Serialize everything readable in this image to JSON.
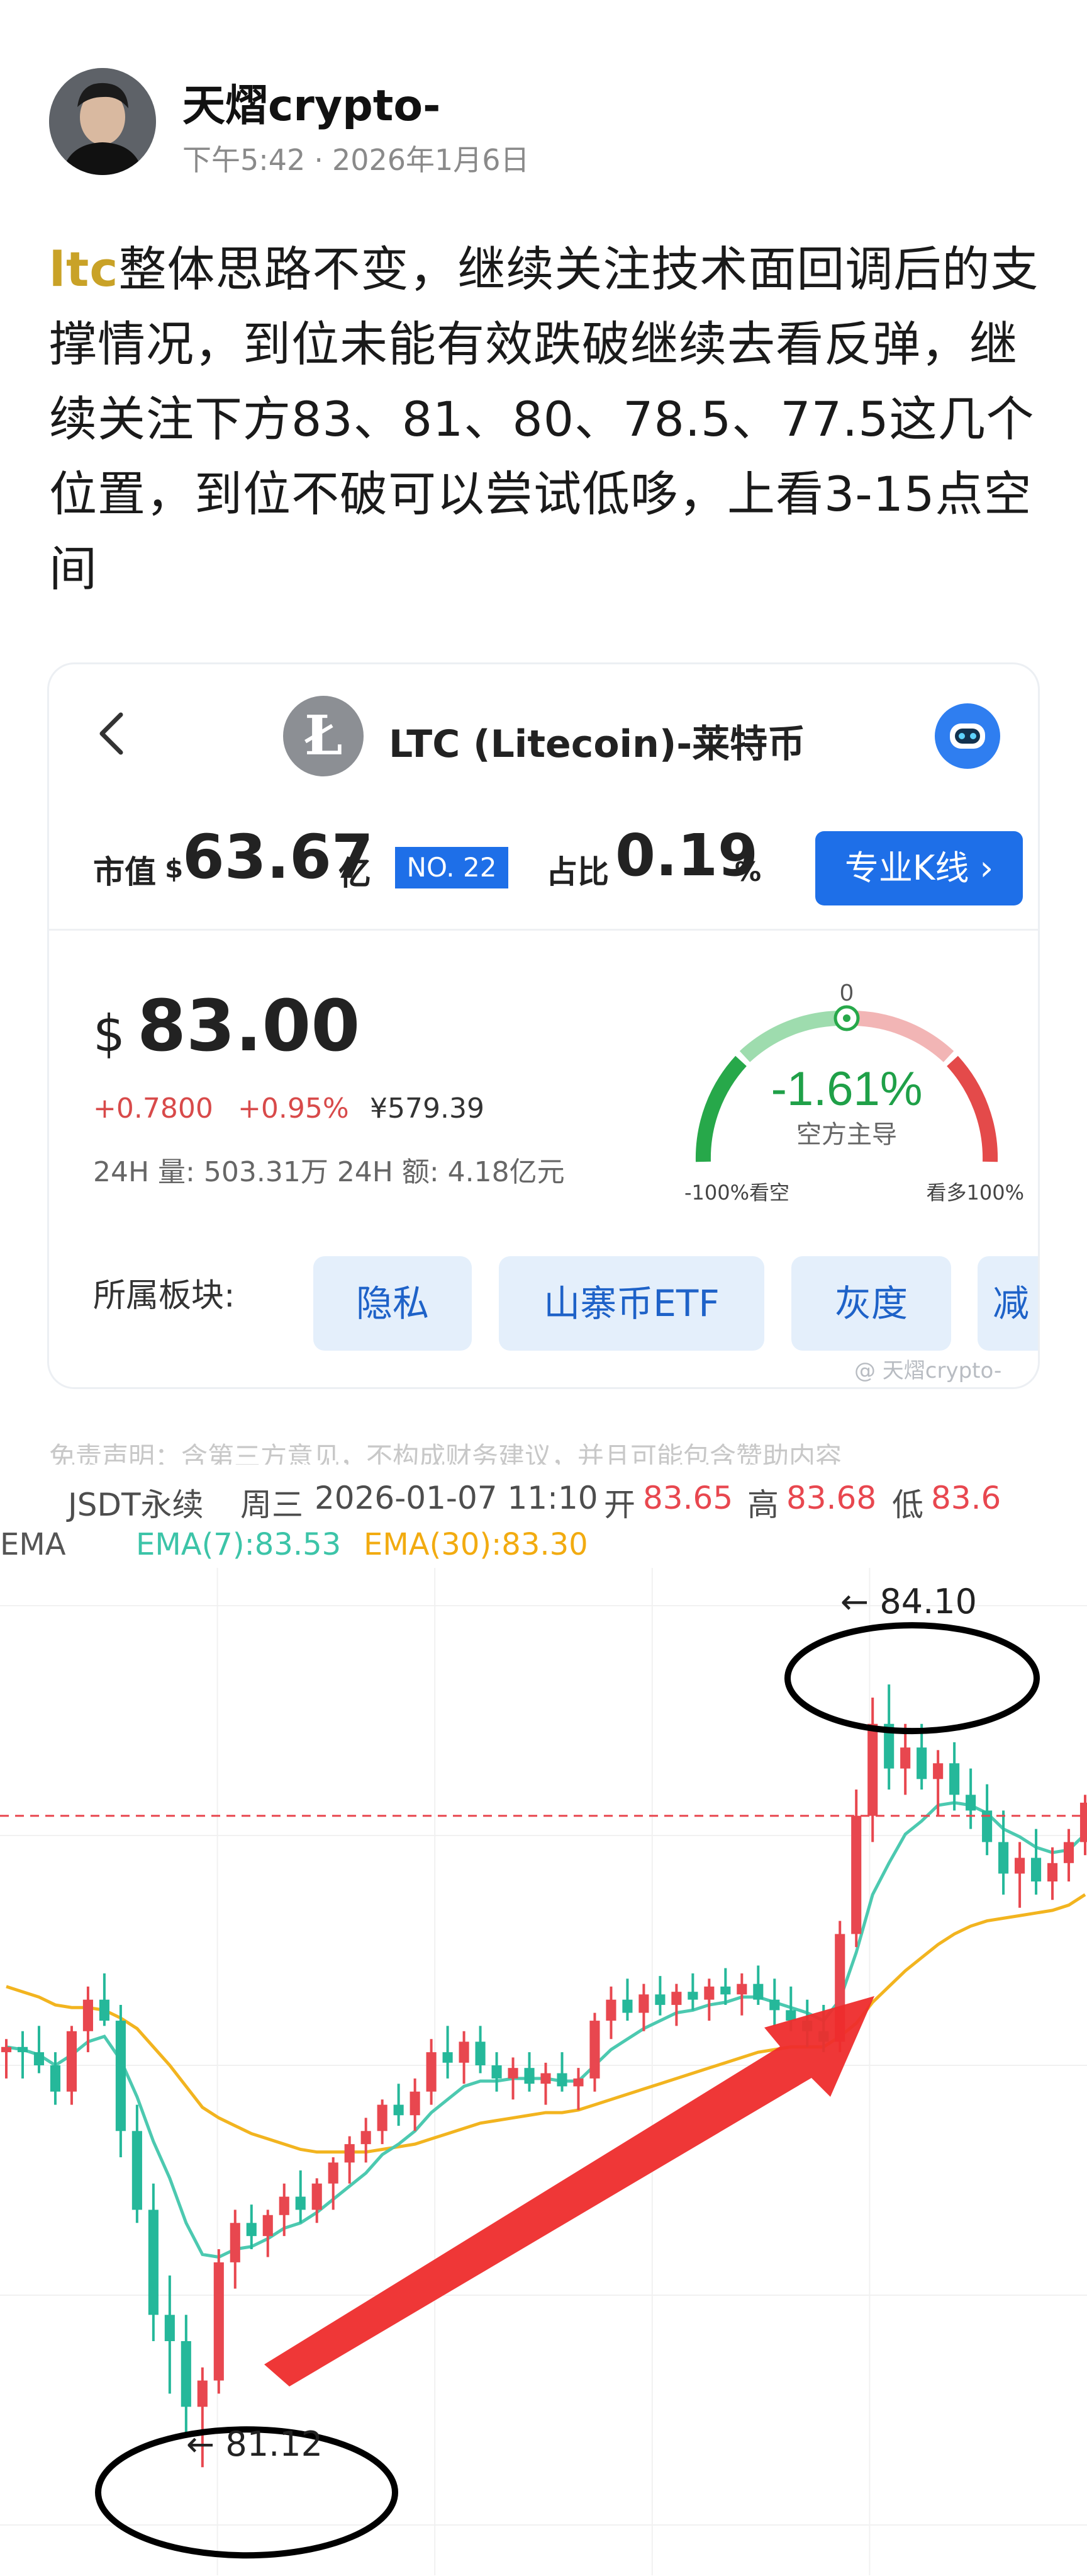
{
  "post": {
    "author": "天熠crypto-",
    "time": "下午5:42",
    "dot": "·",
    "date": "2026年1月6日",
    "tag": "ltc",
    "body": "整体思路不变，继续关注技术面回调后的支撑情况，到位未能有效跌破继续去看反弹，继续关注下方83、81、80、78.5、77.5这几个位置，到位不破可以尝试低哆，上看3-15点空间"
  },
  "coin_card": {
    "title": "LTC (Litecoin)-莱特币",
    "logo_letter": "Ł",
    "market_cap_label": "市值",
    "currency": "$",
    "market_cap_value": "63.67",
    "market_cap_unit": "亿",
    "rank": "NO. 22",
    "share_label": "占比",
    "share_value": "0.19",
    "share_unit": "%",
    "kline_button": "专业K线 ›",
    "price_symbol": "$",
    "price": "83.00",
    "change_abs": "+0.7800",
    "change_pct": "+0.95%",
    "price_cny": "¥579.39",
    "volume_text": "24H 量: 503.31万   24H 额: 4.18亿元",
    "gauge": {
      "top_label": "0",
      "value": "-1.61%",
      "caption": "空方主导",
      "left_label": "-100%看空",
      "right_label": "看多100%",
      "level_pct": -1.61
    },
    "sector_label": "所属板块:",
    "sectors": [
      "隐私",
      "山寨币ETF",
      "灰度",
      "减"
    ],
    "watermark": "@ 天熠crypto-"
  },
  "disclaimer": "免责声明：含第三方意见，不构成财务建议，并且可能包含赞助内容",
  "chart_header": {
    "symbol": "JSDT永续",
    "weekday": "周三",
    "datetime": "2026-01-07 11:10",
    "open_label": "开",
    "open": "83.65",
    "high_label": "高",
    "high": "83.68",
    "low_label": "低",
    "low": "83.6",
    "ema_label": "EMA",
    "ema7": "EMA(7):83.53",
    "ema30": "EMA(30):83.30"
  },
  "chart_data": {
    "type": "candlestick",
    "current_price_line": 83.6,
    "annotations": [
      {
        "text": "← 84.10",
        "price": 84.1
      },
      {
        "text": "← 81.12",
        "price": 81.12
      }
    ],
    "ylim": [
      80.9,
      84.4
    ],
    "candles": [
      [
        82.7,
        82.75,
        82.6,
        82.72
      ],
      [
        82.72,
        82.78,
        82.6,
        82.7
      ],
      [
        82.7,
        82.8,
        82.62,
        82.65
      ],
      [
        82.65,
        82.7,
        82.5,
        82.55
      ],
      [
        82.55,
        82.8,
        82.5,
        82.78
      ],
      [
        82.78,
        82.95,
        82.7,
        82.9
      ],
      [
        82.9,
        83.0,
        82.8,
        82.82
      ],
      [
        82.82,
        82.88,
        82.3,
        82.4
      ],
      [
        82.4,
        82.5,
        82.05,
        82.1
      ],
      [
        82.1,
        82.2,
        81.6,
        81.7
      ],
      [
        81.7,
        81.85,
        81.4,
        81.6
      ],
      [
        81.6,
        81.7,
        81.25,
        81.35
      ],
      [
        81.35,
        81.5,
        81.12,
        81.45
      ],
      [
        81.45,
        81.95,
        81.4,
        81.9
      ],
      [
        81.9,
        82.1,
        81.8,
        82.05
      ],
      [
        82.05,
        82.12,
        81.95,
        82.0
      ],
      [
        82.0,
        82.1,
        81.92,
        82.08
      ],
      [
        82.08,
        82.2,
        82.0,
        82.15
      ],
      [
        82.15,
        82.25,
        82.05,
        82.1
      ],
      [
        82.1,
        82.22,
        82.05,
        82.2
      ],
      [
        82.2,
        82.3,
        82.1,
        82.28
      ],
      [
        82.28,
        82.38,
        82.2,
        82.35
      ],
      [
        82.35,
        82.45,
        82.28,
        82.4
      ],
      [
        82.4,
        82.52,
        82.35,
        82.5
      ],
      [
        82.5,
        82.58,
        82.42,
        82.46
      ],
      [
        82.46,
        82.6,
        82.4,
        82.55
      ],
      [
        82.55,
        82.75,
        82.5,
        82.7
      ],
      [
        82.7,
        82.8,
        82.6,
        82.66
      ],
      [
        82.66,
        82.78,
        82.58,
        82.74
      ],
      [
        82.74,
        82.8,
        82.62,
        82.65
      ],
      [
        82.65,
        82.7,
        82.55,
        82.6
      ],
      [
        82.6,
        82.68,
        82.52,
        82.64
      ],
      [
        82.64,
        82.7,
        82.55,
        82.58
      ],
      [
        82.58,
        82.66,
        82.5,
        82.62
      ],
      [
        82.62,
        82.7,
        82.55,
        82.57
      ],
      [
        82.57,
        82.64,
        82.48,
        82.6
      ],
      [
        82.6,
        82.85,
        82.55,
        82.82
      ],
      [
        82.82,
        82.95,
        82.75,
        82.9
      ],
      [
        82.9,
        82.98,
        82.82,
        82.85
      ],
      [
        82.85,
        82.96,
        82.78,
        82.92
      ],
      [
        82.92,
        82.99,
        82.84,
        82.88
      ],
      [
        82.88,
        82.96,
        82.8,
        82.93
      ],
      [
        82.93,
        83.0,
        82.86,
        82.9
      ],
      [
        82.9,
        82.98,
        82.82,
        82.95
      ],
      [
        82.95,
        83.02,
        82.88,
        82.92
      ],
      [
        82.92,
        83.0,
        82.84,
        82.96
      ],
      [
        82.96,
        83.03,
        82.88,
        82.9
      ],
      [
        82.9,
        82.98,
        82.8,
        82.86
      ],
      [
        82.86,
        82.95,
        82.78,
        82.82
      ],
      [
        82.82,
        82.9,
        82.72,
        82.78
      ],
      [
        82.78,
        82.88,
        82.7,
        82.74
      ],
      [
        82.74,
        83.2,
        82.7,
        83.15
      ],
      [
        83.15,
        83.7,
        83.1,
        83.6
      ],
      [
        83.6,
        84.05,
        83.5,
        83.95
      ],
      [
        83.95,
        84.1,
        83.7,
        83.78
      ],
      [
        83.78,
        83.95,
        83.68,
        83.86
      ],
      [
        83.86,
        83.95,
        83.7,
        83.74
      ],
      [
        83.74,
        83.85,
        83.6,
        83.8
      ],
      [
        83.8,
        83.88,
        83.62,
        83.68
      ],
      [
        83.68,
        83.78,
        83.55,
        83.62
      ],
      [
        83.62,
        83.72,
        83.45,
        83.5
      ],
      [
        83.5,
        83.62,
        83.3,
        83.38
      ],
      [
        83.38,
        83.5,
        83.25,
        83.44
      ],
      [
        83.44,
        83.55,
        83.3,
        83.35
      ],
      [
        83.35,
        83.48,
        83.28,
        83.42
      ],
      [
        83.42,
        83.55,
        83.35,
        83.5
      ],
      [
        83.5,
        83.68,
        83.45,
        83.65
      ]
    ],
    "ema7": [
      82.72,
      82.71,
      82.69,
      82.65,
      82.69,
      82.74,
      82.76,
      82.67,
      82.53,
      82.36,
      82.22,
      82.05,
      81.93,
      81.92,
      81.95,
      81.96,
      81.99,
      82.03,
      82.05,
      82.09,
      82.14,
      82.19,
      82.24,
      82.31,
      82.35,
      82.4,
      82.47,
      82.52,
      82.57,
      82.59,
      82.59,
      82.6,
      82.6,
      82.6,
      82.59,
      82.59,
      82.65,
      82.71,
      82.75,
      82.79,
      82.82,
      82.85,
      82.86,
      82.88,
      82.89,
      82.91,
      82.91,
      82.89,
      82.87,
      82.85,
      82.82,
      82.9,
      83.08,
      83.3,
      83.42,
      83.53,
      83.58,
      83.64,
      83.65,
      83.64,
      83.61,
      83.55,
      83.52,
      83.48,
      83.46,
      83.47,
      83.53
    ],
    "ema30": [
      82.95,
      82.93,
      82.91,
      82.88,
      82.87,
      82.87,
      82.86,
      82.83,
      82.79,
      82.72,
      82.65,
      82.57,
      82.49,
      82.45,
      82.42,
      82.39,
      82.37,
      82.35,
      82.33,
      82.32,
      82.32,
      82.32,
      82.32,
      82.33,
      82.34,
      82.35,
      82.37,
      82.39,
      82.41,
      82.43,
      82.44,
      82.45,
      82.46,
      82.47,
      82.47,
      82.48,
      82.5,
      82.52,
      82.54,
      82.56,
      82.58,
      82.6,
      82.62,
      82.64,
      82.66,
      82.68,
      82.7,
      82.71,
      82.72,
      82.72,
      82.72,
      82.76,
      82.81,
      82.89,
      82.95,
      83.01,
      83.06,
      83.11,
      83.15,
      83.18,
      83.2,
      83.21,
      83.22,
      83.23,
      83.24,
      83.26,
      83.3
    ],
    "colors": {
      "up": "#e8474f",
      "down": "#25b89a",
      "ema7": "#4cc9b0",
      "ema30": "#f2b41f",
      "price_line": "#e8474f",
      "arrow": "#ee2c2c"
    }
  }
}
